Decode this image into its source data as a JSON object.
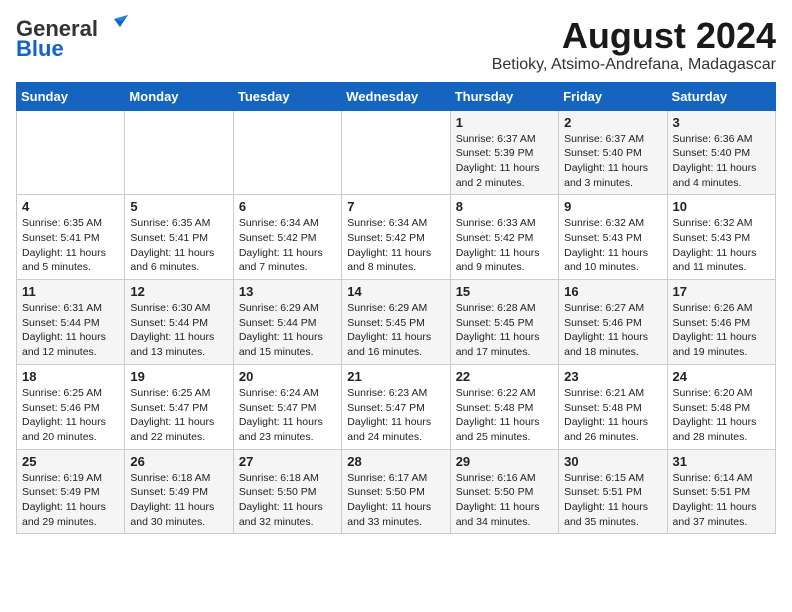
{
  "header": {
    "logo_general": "General",
    "logo_blue": "Blue",
    "title": "August 2024",
    "subtitle": "Betioky, Atsimo-Andrefana, Madagascar"
  },
  "calendar": {
    "weekdays": [
      "Sunday",
      "Monday",
      "Tuesday",
      "Wednesday",
      "Thursday",
      "Friday",
      "Saturday"
    ],
    "weeks": [
      [
        {
          "day": "",
          "sunrise": "",
          "sunset": "",
          "daylight": ""
        },
        {
          "day": "",
          "sunrise": "",
          "sunset": "",
          "daylight": ""
        },
        {
          "day": "",
          "sunrise": "",
          "sunset": "",
          "daylight": ""
        },
        {
          "day": "",
          "sunrise": "",
          "sunset": "",
          "daylight": ""
        },
        {
          "day": "1",
          "sunrise": "6:37 AM",
          "sunset": "5:39 PM",
          "daylight": "11 hours and 2 minutes."
        },
        {
          "day": "2",
          "sunrise": "6:37 AM",
          "sunset": "5:40 PM",
          "daylight": "11 hours and 3 minutes."
        },
        {
          "day": "3",
          "sunrise": "6:36 AM",
          "sunset": "5:40 PM",
          "daylight": "11 hours and 4 minutes."
        }
      ],
      [
        {
          "day": "4",
          "sunrise": "6:35 AM",
          "sunset": "5:41 PM",
          "daylight": "11 hours and 5 minutes."
        },
        {
          "day": "5",
          "sunrise": "6:35 AM",
          "sunset": "5:41 PM",
          "daylight": "11 hours and 6 minutes."
        },
        {
          "day": "6",
          "sunrise": "6:34 AM",
          "sunset": "5:42 PM",
          "daylight": "11 hours and 7 minutes."
        },
        {
          "day": "7",
          "sunrise": "6:34 AM",
          "sunset": "5:42 PM",
          "daylight": "11 hours and 8 minutes."
        },
        {
          "day": "8",
          "sunrise": "6:33 AM",
          "sunset": "5:42 PM",
          "daylight": "11 hours and 9 minutes."
        },
        {
          "day": "9",
          "sunrise": "6:32 AM",
          "sunset": "5:43 PM",
          "daylight": "11 hours and 10 minutes."
        },
        {
          "day": "10",
          "sunrise": "6:32 AM",
          "sunset": "5:43 PM",
          "daylight": "11 hours and 11 minutes."
        }
      ],
      [
        {
          "day": "11",
          "sunrise": "6:31 AM",
          "sunset": "5:44 PM",
          "daylight": "11 hours and 12 minutes."
        },
        {
          "day": "12",
          "sunrise": "6:30 AM",
          "sunset": "5:44 PM",
          "daylight": "11 hours and 13 minutes."
        },
        {
          "day": "13",
          "sunrise": "6:29 AM",
          "sunset": "5:44 PM",
          "daylight": "11 hours and 15 minutes."
        },
        {
          "day": "14",
          "sunrise": "6:29 AM",
          "sunset": "5:45 PM",
          "daylight": "11 hours and 16 minutes."
        },
        {
          "day": "15",
          "sunrise": "6:28 AM",
          "sunset": "5:45 PM",
          "daylight": "11 hours and 17 minutes."
        },
        {
          "day": "16",
          "sunrise": "6:27 AM",
          "sunset": "5:46 PM",
          "daylight": "11 hours and 18 minutes."
        },
        {
          "day": "17",
          "sunrise": "6:26 AM",
          "sunset": "5:46 PM",
          "daylight": "11 hours and 19 minutes."
        }
      ],
      [
        {
          "day": "18",
          "sunrise": "6:25 AM",
          "sunset": "5:46 PM",
          "daylight": "11 hours and 20 minutes."
        },
        {
          "day": "19",
          "sunrise": "6:25 AM",
          "sunset": "5:47 PM",
          "daylight": "11 hours and 22 minutes."
        },
        {
          "day": "20",
          "sunrise": "6:24 AM",
          "sunset": "5:47 PM",
          "daylight": "11 hours and 23 minutes."
        },
        {
          "day": "21",
          "sunrise": "6:23 AM",
          "sunset": "5:47 PM",
          "daylight": "11 hours and 24 minutes."
        },
        {
          "day": "22",
          "sunrise": "6:22 AM",
          "sunset": "5:48 PM",
          "daylight": "11 hours and 25 minutes."
        },
        {
          "day": "23",
          "sunrise": "6:21 AM",
          "sunset": "5:48 PM",
          "daylight": "11 hours and 26 minutes."
        },
        {
          "day": "24",
          "sunrise": "6:20 AM",
          "sunset": "5:48 PM",
          "daylight": "11 hours and 28 minutes."
        }
      ],
      [
        {
          "day": "25",
          "sunrise": "6:19 AM",
          "sunset": "5:49 PM",
          "daylight": "11 hours and 29 minutes."
        },
        {
          "day": "26",
          "sunrise": "6:18 AM",
          "sunset": "5:49 PM",
          "daylight": "11 hours and 30 minutes."
        },
        {
          "day": "27",
          "sunrise": "6:18 AM",
          "sunset": "5:50 PM",
          "daylight": "11 hours and 32 minutes."
        },
        {
          "day": "28",
          "sunrise": "6:17 AM",
          "sunset": "5:50 PM",
          "daylight": "11 hours and 33 minutes."
        },
        {
          "day": "29",
          "sunrise": "6:16 AM",
          "sunset": "5:50 PM",
          "daylight": "11 hours and 34 minutes."
        },
        {
          "day": "30",
          "sunrise": "6:15 AM",
          "sunset": "5:51 PM",
          "daylight": "11 hours and 35 minutes."
        },
        {
          "day": "31",
          "sunrise": "6:14 AM",
          "sunset": "5:51 PM",
          "daylight": "11 hours and 37 minutes."
        }
      ]
    ]
  }
}
